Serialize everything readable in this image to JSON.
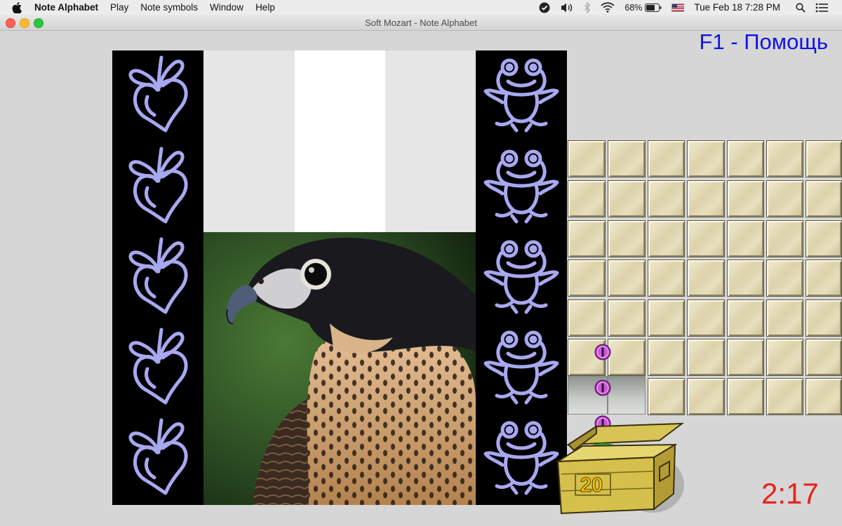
{
  "menubar": {
    "app_name": "Note Alphabet",
    "items": [
      "Play",
      "Note symbols",
      "Window",
      "Help"
    ],
    "battery": "68%",
    "clock": "Tue Feb 18  7:28 PM"
  },
  "window": {
    "title": "Soft Mozart - Note Alphabet"
  },
  "game": {
    "help_label": "F1 - Помощь",
    "timer": "2:17",
    "chest_count": "20",
    "left_column_icon": "beet-icon",
    "right_column_icon": "frog-icon",
    "photo": "falcon-photo",
    "coin_symbol": "I"
  },
  "colors": {
    "help_text": "#1212e6",
    "timer_text": "#e8231c",
    "icon_outline": "#a8a8f0",
    "coin": "#9b2aa8"
  }
}
